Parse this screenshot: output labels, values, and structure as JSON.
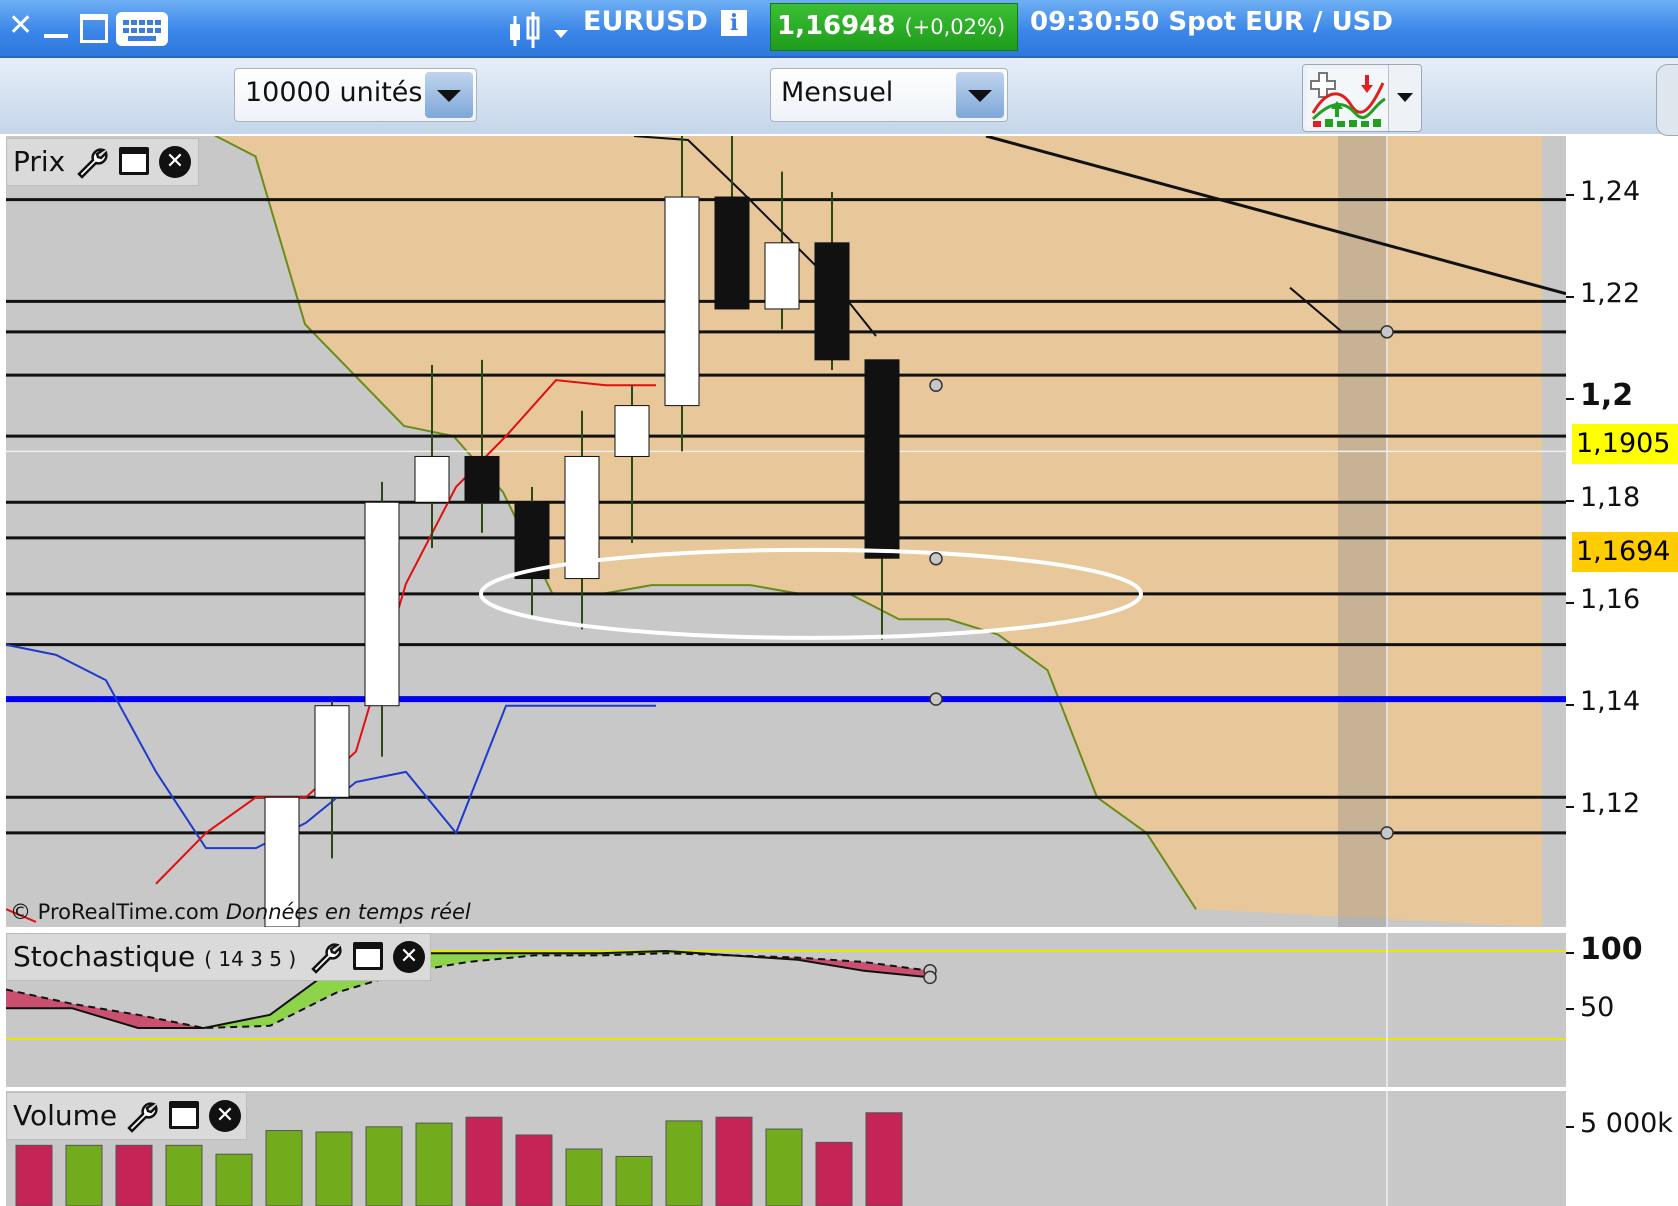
{
  "window": {
    "symbol": "EURUSD",
    "last_price": "1,16948",
    "change": "(+0,02%)",
    "time_text": "09:30:50 Spot EUR / USD",
    "colors": {
      "titlebar": "#3b86e8",
      "price_up": "#23a321",
      "price_tag_yellow": "#ffff00",
      "price_tag_orange": "#ffcc00"
    }
  },
  "toolbar": {
    "quantity": "10000 unités",
    "timeframe": "Mensuel"
  },
  "price_panel": {
    "title": "Prix",
    "watermark_brand": "© ProRealTime.com",
    "watermark_note": "Données en temps réel",
    "axis_labels": [
      "1,24",
      "1,22",
      "1,2",
      "1,18",
      "1,16",
      "1,14",
      "1,12"
    ],
    "price_tag_1": "1,1905",
    "price_tag_2": "1,1694"
  },
  "stoch_panel": {
    "title": "Stochastique",
    "params": "( 14 3 5 )",
    "axis_labels": [
      "100",
      "50"
    ]
  },
  "volume_panel": {
    "title": "Volume",
    "axis_label": "5 000k"
  },
  "chart_data": {
    "type": "candlestick",
    "ylim": [
      1.097,
      1.2525
    ],
    "candles": [
      {
        "o": 1.097,
        "h": 1.1225,
        "l": 1.097,
        "c": 1.1225
      },
      {
        "o": 1.1225,
        "h": 1.1415,
        "l": 1.1105,
        "c": 1.1405
      },
      {
        "o": 1.1405,
        "h": 1.1845,
        "l": 1.1305,
        "c": 1.1805
      },
      {
        "o": 1.1805,
        "h": 1.2075,
        "l": 1.1715,
        "c": 1.1895
      },
      {
        "o": 1.1895,
        "h": 1.2085,
        "l": 1.1745,
        "c": 1.1805
      },
      {
        "o": 1.1805,
        "h": 1.1835,
        "l": 1.1575,
        "c": 1.1655
      },
      {
        "o": 1.1655,
        "h": 1.1985,
        "l": 1.1555,
        "c": 1.1895
      },
      {
        "o": 1.1895,
        "h": 1.2035,
        "l": 1.1725,
        "c": 1.1995
      },
      {
        "o": 1.1995,
        "h": 1.2525,
        "l": 1.1905,
        "c": 1.2405
      },
      {
        "o": 1.2405,
        "h": 1.2525,
        "l": 1.2185,
        "c": 1.2185
      },
      {
        "o": 1.2185,
        "h": 1.2455,
        "l": 1.2145,
        "c": 1.2315
      },
      {
        "o": 1.2315,
        "h": 1.2415,
        "l": 1.2065,
        "c": 1.2085
      },
      {
        "o": 1.2085,
        "h": 1.2085,
        "l": 1.1535,
        "c": 1.1695
      }
    ],
    "horizontal_levels": [
      1.24,
      1.22,
      1.214,
      1.2055,
      1.1935,
      1.1805,
      1.1735,
      1.1625,
      1.1525,
      1.1225,
      1.1155
    ],
    "blue_level": 1.1418,
    "red_line": [
      1.1005,
      null,
      1.0975,
      1.1055,
      1.1155,
      1.1225,
      1.1225,
      1.1315,
      1.1645,
      1.1835,
      1.1935,
      1.2045,
      1.2035,
      1.2035
    ],
    "blue_line": [
      1.1525,
      1.1505,
      1.1455,
      1.1275,
      1.1125,
      1.1125,
      1.1175,
      1.1255,
      1.1275,
      1.1155,
      1.1405,
      1.1405,
      1.1405,
      1.1405
    ],
    "cloud_line": [
      1.2535,
      1.2485,
      1.2155,
      1.2055,
      1.1955,
      1.1935,
      1.1825,
      1.1625,
      1.1625,
      1.1642,
      1.1642,
      1.1642,
      1.1625,
      1.1625,
      1.1575,
      1.1575,
      1.1545,
      1.1475,
      1.1225,
      1.1155,
      1.1005
    ],
    "stoch_k": [
      48,
      48,
      30,
      30,
      42,
      86,
      98,
      98,
      98,
      98,
      100,
      96,
      92,
      82,
      76
    ],
    "stoch_d": [
      65,
      52,
      42,
      30,
      32,
      62,
      80,
      90,
      96,
      96,
      98,
      96,
      94,
      90,
      82
    ],
    "volume": [
      {
        "v": 0.82,
        "up": false
      },
      {
        "v": 0.82,
        "up": true
      },
      {
        "v": 0.82,
        "up": false
      },
      {
        "v": 0.82,
        "up": true
      },
      {
        "v": 0.7,
        "up": true
      },
      {
        "v": 1.02,
        "up": true
      },
      {
        "v": 1.0,
        "up": true
      },
      {
        "v": 1.07,
        "up": true
      },
      {
        "v": 1.12,
        "up": true
      },
      {
        "v": 1.2,
        "up": false
      },
      {
        "v": 0.96,
        "up": false
      },
      {
        "v": 0.77,
        "up": true
      },
      {
        "v": 0.67,
        "up": true
      },
      {
        "v": 1.15,
        "up": true
      },
      {
        "v": 1.2,
        "up": false
      },
      {
        "v": 1.04,
        "up": true
      },
      {
        "v": 0.86,
        "up": false
      },
      {
        "v": 1.26,
        "up": false
      }
    ]
  }
}
